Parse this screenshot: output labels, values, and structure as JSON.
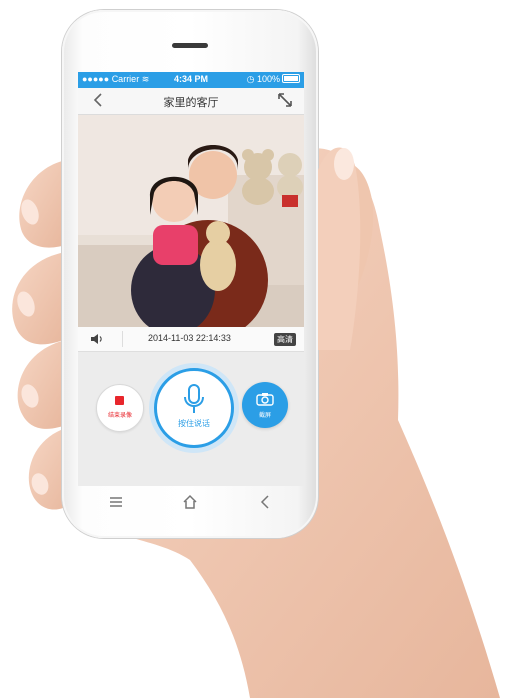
{
  "status_bar": {
    "carrier": "Carrier",
    "time": "4:34 PM",
    "battery": "100%"
  },
  "nav": {
    "title": "家里的客厅"
  },
  "info_bar": {
    "timestamp": "2014-11-03 22:14:33",
    "quality": "高清"
  },
  "controls": {
    "record_label": "结束录像",
    "talk_label": "按住说话",
    "snapshot_label": "截屏"
  },
  "icons": {
    "back": "chevron-left-icon",
    "expand": "expand-arrows-icon",
    "volume": "speaker-icon",
    "stop": "stop-square-icon",
    "mic": "microphone-icon",
    "camera": "camera-icon",
    "menu": "menu-icon",
    "home": "home-icon",
    "nav_back": "back-icon"
  },
  "colors": {
    "accent": "#2b9ee6",
    "record": "#e8262c"
  }
}
